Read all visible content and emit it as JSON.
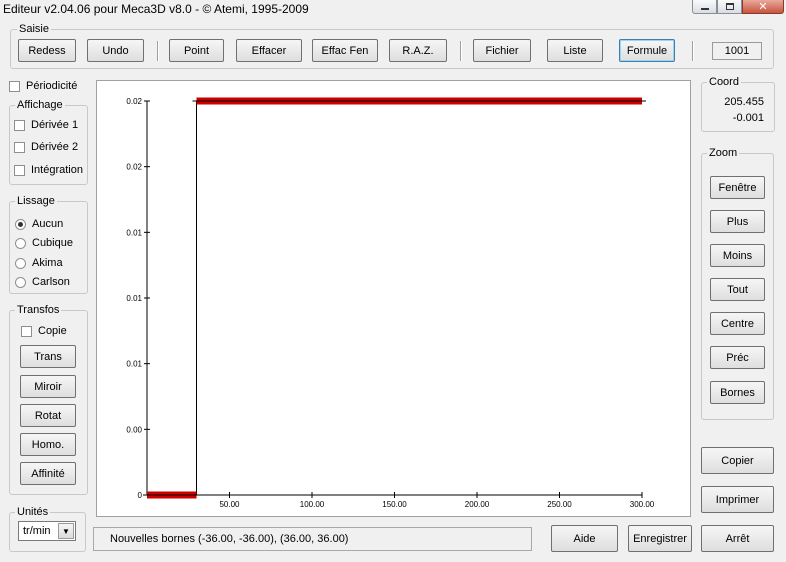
{
  "window": {
    "title": "Editeur v2.04.06 pour Meca3D v8.0 - © Atemi, 1995-2009",
    "controls": {
      "minimize_icon": "minimize-icon",
      "maximize_icon": "maximize-icon",
      "close_icon": "close-icon",
      "close_glyph": "✕"
    }
  },
  "saisie": {
    "label": "Saisie",
    "buttons": [
      "Redess",
      "Undo",
      "Point",
      "Effacer",
      "Effac Fen",
      "R.A.Z.",
      "Fichier",
      "Liste",
      "Formule"
    ],
    "counter": "1001"
  },
  "periodicite": {
    "label": "Périodicité",
    "checked": false
  },
  "affichage": {
    "label": "Affichage",
    "items": [
      {
        "label": "Dérivée 1",
        "checked": false
      },
      {
        "label": "Dérivée 2",
        "checked": false
      },
      {
        "label": "Intégration",
        "checked": false
      }
    ]
  },
  "lissage": {
    "label": "Lissage",
    "options": [
      {
        "label": "Aucun",
        "selected": true
      },
      {
        "label": "Cubique",
        "selected": false
      },
      {
        "label": "Akima",
        "selected": false
      },
      {
        "label": "Carlson",
        "selected": false
      }
    ]
  },
  "transfos": {
    "label": "Transfos",
    "copie": {
      "label": "Copie",
      "checked": false
    },
    "buttons": [
      "Trans",
      "Miroir",
      "Rotat",
      "Homo.",
      "Affinité"
    ]
  },
  "unites": {
    "label": "Unités",
    "value": "tr/min"
  },
  "coord": {
    "label": "Coord",
    "x": "205.455",
    "y": "-0.001"
  },
  "zoom": {
    "label": "Zoom",
    "buttons": [
      "Fenêtre",
      "Plus",
      "Moins",
      "Tout",
      "Centre",
      "Préc",
      "Bornes"
    ]
  },
  "actions": {
    "copier": "Copier",
    "imprimer": "Imprimer",
    "aide": "Aide",
    "enregistrer": "Enregistrer",
    "arret": "Arrêt"
  },
  "status": "Nouvelles bornes (-36.00, -36.00), (36.00, 36.00)",
  "chart_data": {
    "type": "line",
    "x_ticks": [
      "50.00",
      "100.00",
      "150.00",
      "200.00",
      "250.00",
      "300.00"
    ],
    "y_ticks": [
      "0",
      "0.00",
      "0.01",
      "0.01",
      "0.01",
      "0.02",
      "0.02"
    ],
    "xlim": [
      0,
      300
    ],
    "ylim": [
      0,
      0.02
    ],
    "series": [
      {
        "x": [
          0,
          30,
          30,
          300
        ],
        "y": [
          0,
          0,
          0.02,
          0.02
        ],
        "color": "#000000"
      }
    ],
    "highlight_segments": [
      {
        "x": [
          0,
          30
        ],
        "y": [
          0,
          0
        ],
        "color": "#cc0000"
      },
      {
        "x": [
          30,
          300
        ],
        "y": [
          0.02,
          0.02
        ],
        "color": "#cc0000"
      }
    ]
  }
}
